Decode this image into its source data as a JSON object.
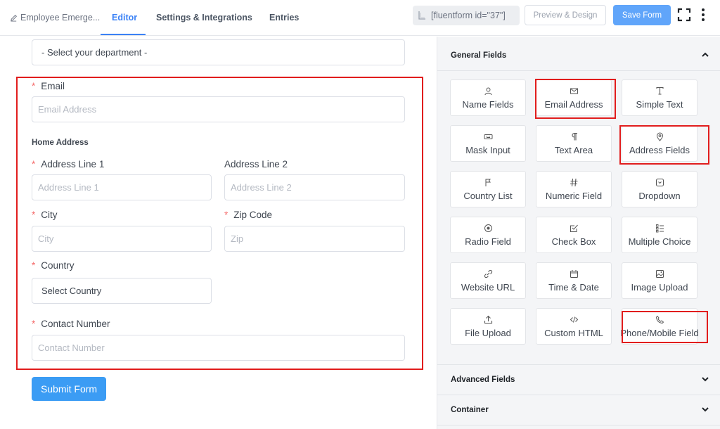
{
  "header": {
    "breadcrumb": "Employee Emerge...",
    "tabs": [
      "Editor",
      "Settings & Integrations",
      "Entries"
    ],
    "shortcode": "[fluentform id=\"37\"]",
    "preview_label": "Preview & Design",
    "save_label": "Save Form"
  },
  "form": {
    "department_select": "- Select your department -",
    "email": {
      "label": "Email",
      "placeholder": "Email Address"
    },
    "home_address_title": "Home Address",
    "address1": {
      "label": "Address Line 1",
      "placeholder": "Address Line 1"
    },
    "address2": {
      "label": "Address Line 2",
      "placeholder": "Address Line 2"
    },
    "city": {
      "label": "City",
      "placeholder": "City"
    },
    "zip": {
      "label": "Zip Code",
      "placeholder": "Zip"
    },
    "country": {
      "label": "Country",
      "value": "Select Country"
    },
    "contact": {
      "label": "Contact Number",
      "placeholder": "Contact Number"
    },
    "required_mark": "*",
    "submit_label": "Submit Form"
  },
  "panel": {
    "general_title": "General Fields",
    "advanced_title": "Advanced Fields",
    "container_title": "Container",
    "fields": [
      {
        "label": "Name Fields",
        "icon": "user-icon"
      },
      {
        "label": "Email Address",
        "icon": "envelope-icon"
      },
      {
        "label": "Simple Text",
        "icon": "text-icon"
      },
      {
        "label": "Mask Input",
        "icon": "keyboard-icon"
      },
      {
        "label": "Text Area",
        "icon": "paragraph-icon"
      },
      {
        "label": "Address Fields",
        "icon": "map-pin-icon"
      },
      {
        "label": "Country List",
        "icon": "flag-icon"
      },
      {
        "label": "Numeric Field",
        "icon": "hash-icon"
      },
      {
        "label": "Dropdown",
        "icon": "dropdown-icon"
      },
      {
        "label": "Radio Field",
        "icon": "radio-icon"
      },
      {
        "label": "Check Box",
        "icon": "checkbox-icon"
      },
      {
        "label": "Multiple Choice",
        "icon": "list-icon"
      },
      {
        "label": "Website URL",
        "icon": "link-icon"
      },
      {
        "label": "Time & Date",
        "icon": "calendar-icon"
      },
      {
        "label": "Image Upload",
        "icon": "image-icon"
      },
      {
        "label": "File Upload",
        "icon": "upload-icon"
      },
      {
        "label": "Custom HTML",
        "icon": "code-icon"
      },
      {
        "label": "Phone/Mobile Field",
        "icon": "phone-icon"
      }
    ]
  },
  "colors": {
    "accent": "#3b82f6",
    "highlight": "#e11d1d",
    "required": "#f56c6c"
  }
}
